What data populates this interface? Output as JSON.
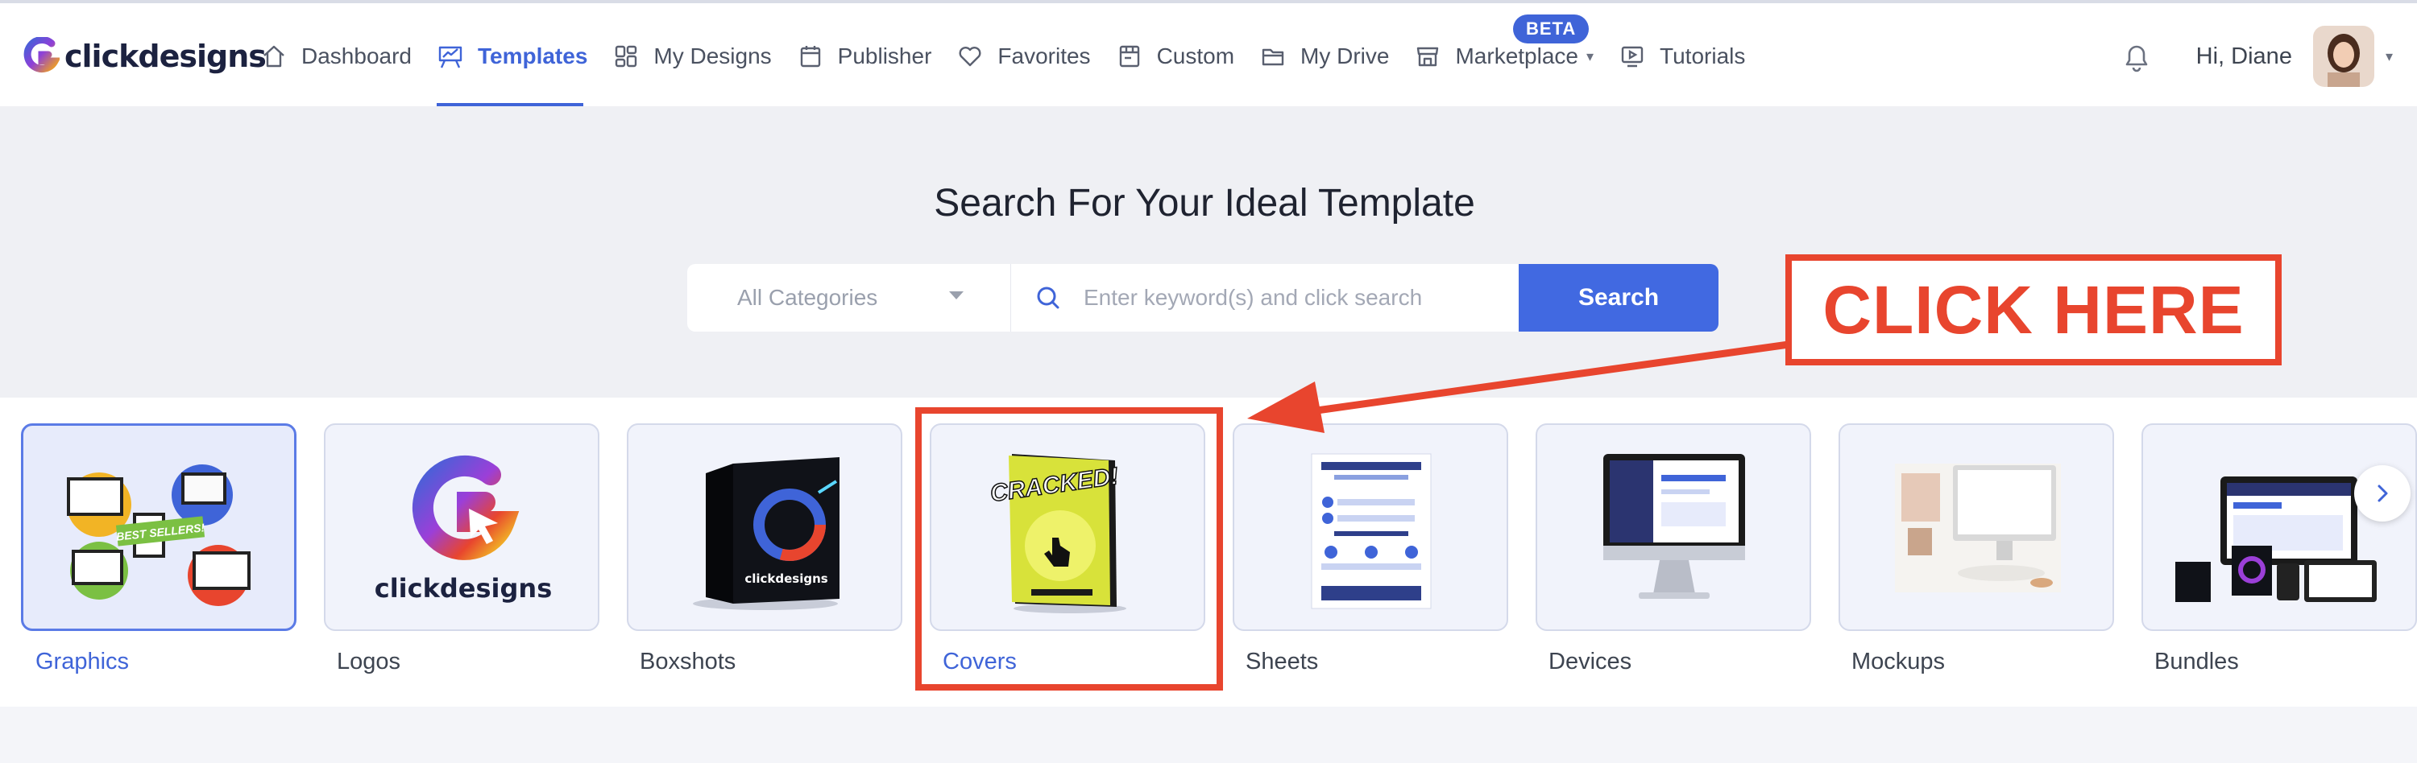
{
  "brand": {
    "name": "clickdesigns"
  },
  "nav": {
    "items": [
      {
        "label": "Dashboard",
        "icon": "home-icon"
      },
      {
        "label": "Templates",
        "icon": "easel-icon",
        "active": true
      },
      {
        "label": "My Designs",
        "icon": "grid-icon"
      },
      {
        "label": "Publisher",
        "icon": "calendar-icon"
      },
      {
        "label": "Favorites",
        "icon": "heart-icon"
      },
      {
        "label": "Custom",
        "icon": "box-icon"
      },
      {
        "label": "My Drive",
        "icon": "folder-icon"
      },
      {
        "label": "Marketplace",
        "icon": "store-icon",
        "badge": "BETA"
      },
      {
        "label": "Tutorials",
        "icon": "video-icon"
      }
    ]
  },
  "user": {
    "greeting": "Hi, Diane"
  },
  "hero": {
    "title": "Search For Your Ideal Template",
    "category_select": "All Categories",
    "search_placeholder": "Enter keyword(s) and click search",
    "search_button": "Search"
  },
  "categories": [
    {
      "label": "Graphics",
      "selected": true
    },
    {
      "label": "Logos"
    },
    {
      "label": "Boxshots"
    },
    {
      "label": "Covers",
      "highlighted": true
    },
    {
      "label": "Sheets"
    },
    {
      "label": "Devices"
    },
    {
      "label": "Mockups"
    },
    {
      "label": "Bundles"
    }
  ],
  "card_art": {
    "logos_caption": "clickdesigns",
    "graphics_badge": "BEST SELLERS!",
    "cover_title": "CRACKED!"
  },
  "annotation": {
    "callout": "CLICK HERE"
  },
  "colors": {
    "accent": "#4169e1",
    "annotation": "#e8452e"
  }
}
